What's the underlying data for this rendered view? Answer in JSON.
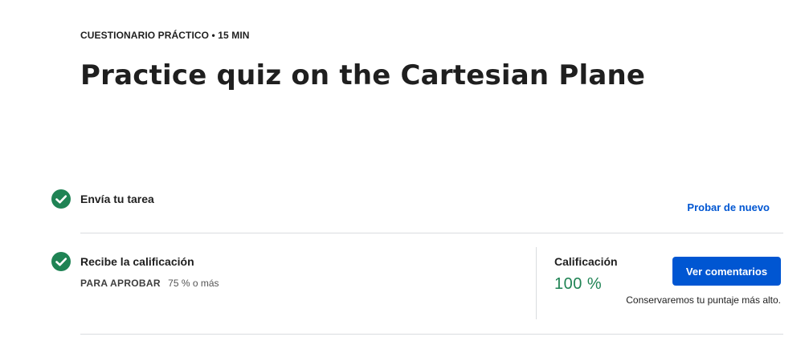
{
  "header": {
    "eyebrow": "CUESTIONARIO PRÁCTICO • 15 MIN",
    "title": "Practice quiz on the Cartesian Plane"
  },
  "steps": [
    {
      "label": "Envía tu tarea",
      "status_icon": "check-circle-icon"
    },
    {
      "label": "Recibe la calificación",
      "status_icon": "check-circle-icon"
    }
  ],
  "retry": {
    "label": "Probar de nuevo"
  },
  "passing": {
    "label": "PARA APROBAR",
    "value": "75 % o más"
  },
  "grade": {
    "label": "Calificación",
    "value": "100 %",
    "button_label": "Ver comentarios",
    "note": "Conservaremos tu puntaje más alto."
  },
  "colors": {
    "success": "#1f8354",
    "primary": "#0056d2"
  }
}
